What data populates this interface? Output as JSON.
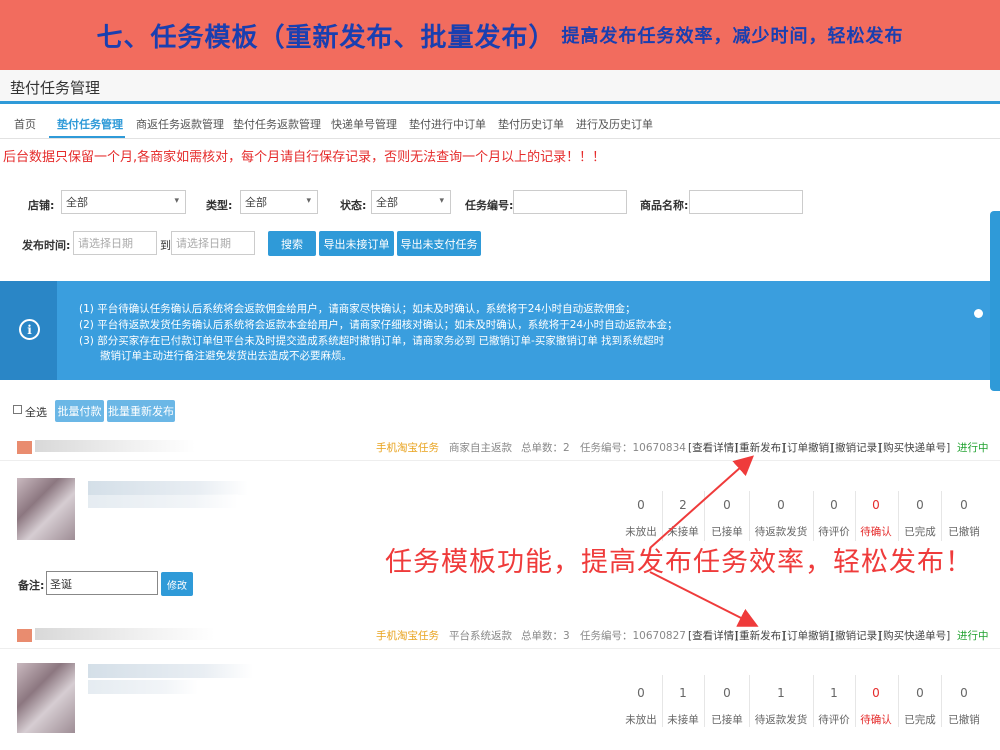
{
  "banner": {
    "title": "七、任务模板（重新发布、批量发布）",
    "subtitle": "提高发布任务效率，减少时间，轻松发布"
  },
  "page_title": "垫付任务管理",
  "tabs": [
    "首页",
    "垫付任务管理",
    "商返任务返款管理",
    "垫付任务返款管理",
    "快递单号管理",
    "垫付进行中订单",
    "垫付历史订单",
    "进行及历史订单"
  ],
  "warning": "后台数据只保留一个月,各商家如需核对，每个月请自行保存记录，否则无法查询一个月以上的记录！！！",
  "filters": {
    "shop_label": "店铺:",
    "shop_value": "全部",
    "type_label": "类型:",
    "type_value": "全部",
    "status_label": "状态:",
    "status_value": "全部",
    "task_no_label": "任务编号:",
    "product_name_label": "商品名称:",
    "publish_time_label": "发布时间:",
    "date_placeholder": "请选择日期",
    "to_label": "到"
  },
  "buttons": {
    "search": "搜索",
    "export_unaccepted": "导出未接订单",
    "export_unpaid": "导出未支付任务",
    "batch_pay": "批量付款",
    "batch_republish": "批量重新发布",
    "modify": "修改"
  },
  "notice": [
    "(1) 平台待确认任务确认后系统将会返款佣金给用户，请商家尽快确认；如未及时确认，系统将于24小时自动返款佣金；",
    "(2) 平台待返款发货任务确认后系统将会返款本金给用户，请商家仔细核对确认；如未及时确认，系统将于24小时自动返款本金；",
    "(3) 部分买家存在已付款订单但平台未及时提交造成系统超时撤销订单，请商家务必到 已撤销订单-买家撤销订单 找到系统超时",
    "     撤销订单主动进行备注避免发货出去造成不必要麻烦。"
  ],
  "select_all": "全选",
  "orders": [
    {
      "platform": "手机淘宝任务",
      "refund_type": "商家自主返款",
      "total": "总单数：2",
      "task_no": "任务编号：10670834",
      "actions": [
        "[查看详情]",
        "[重新发布]",
        "[订单撤销]",
        "[撤销记录]",
        "[购买快递单号]"
      ],
      "state": "进行中",
      "stats": [
        {
          "label": "未放出",
          "value": "0"
        },
        {
          "label": "未接单",
          "value": "2"
        },
        {
          "label": "已接单",
          "value": "0"
        },
        {
          "label": "待返款发货",
          "value": "0"
        },
        {
          "label": "待评价",
          "value": "0"
        },
        {
          "label": "待确认",
          "value": "0"
        },
        {
          "label": "已完成",
          "value": "0"
        },
        {
          "label": "已撤销",
          "value": "0"
        }
      ],
      "remark_label": "备注:",
      "remark_value": "圣诞"
    },
    {
      "platform": "手机淘宝任务",
      "refund_type": "平台系统返款",
      "total": "总单数：3",
      "task_no": "任务编号：10670827",
      "actions": [
        "[查看详情]",
        "[重新发布]",
        "[订单撤销]",
        "[撤销记录]",
        "[购买快递单号]"
      ],
      "state": "进行中",
      "stats": [
        {
          "label": "未放出",
          "value": "0"
        },
        {
          "label": "未接单",
          "value": "1"
        },
        {
          "label": "已接单",
          "value": "0"
        },
        {
          "label": "待返款发货",
          "value": "1"
        },
        {
          "label": "待评价",
          "value": "1"
        },
        {
          "label": "待确认",
          "value": "0"
        },
        {
          "label": "已完成",
          "value": "0"
        },
        {
          "label": "已撤销",
          "value": "0"
        }
      ]
    }
  ],
  "annotation": "任务模板功能，提高发布任务效率，轻松发布！",
  "colors": {
    "banner_bg": "#f26c5e",
    "banner_text": "#1a3fb0",
    "primary": "#2f9ad8",
    "warning_red": "#e52b2b",
    "annotation_red": "#ef3b3b",
    "running_green": "#1fa12e",
    "platform_orange": "#e8a21c"
  }
}
